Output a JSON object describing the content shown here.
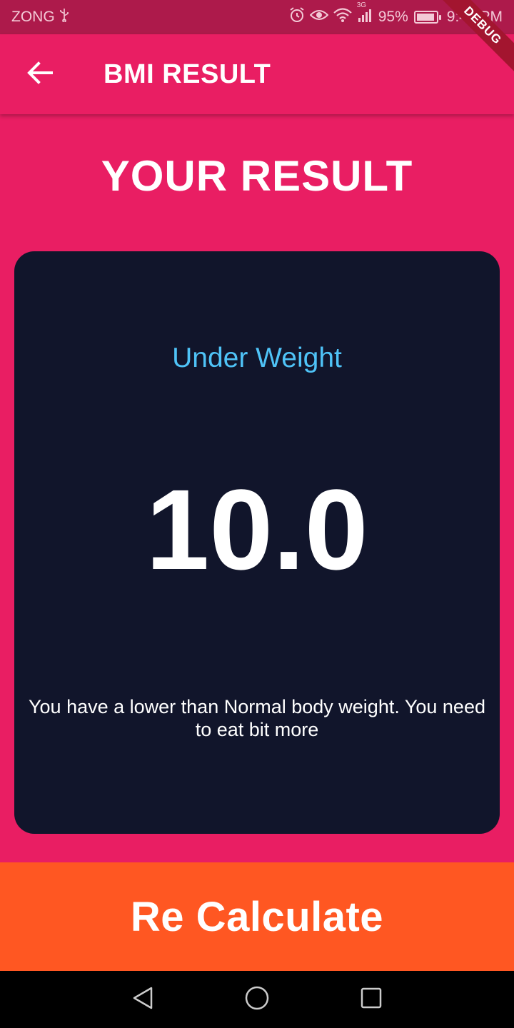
{
  "status_bar": {
    "carrier": "ZONG",
    "network": "3G",
    "battery": "95%",
    "time": "9:40 PM",
    "icons": [
      "usb-icon",
      "alarm-icon",
      "eye-icon",
      "wifi-icon",
      "signal-icon",
      "battery-charging-icon"
    ]
  },
  "debug_banner": "DEBUG",
  "app_bar": {
    "title": "BMI RESULT",
    "back_icon": "arrow-back-icon"
  },
  "main": {
    "heading": "YOUR RESULT",
    "card": {
      "category": "Under Weight",
      "bmi": "10.0",
      "advice": "You have a lower than Normal body weight. You need to eat bit more"
    },
    "recalculate_label": "Re Calculate"
  },
  "nav_bar": {
    "icons": [
      "back-triangle-icon",
      "home-circle-icon",
      "recents-square-icon"
    ]
  },
  "colors": {
    "primary": "#e91e63",
    "status_bar": "#ad1a4b",
    "card": "#11152b",
    "category": "#4fc3f7",
    "button": "#ff5722"
  }
}
